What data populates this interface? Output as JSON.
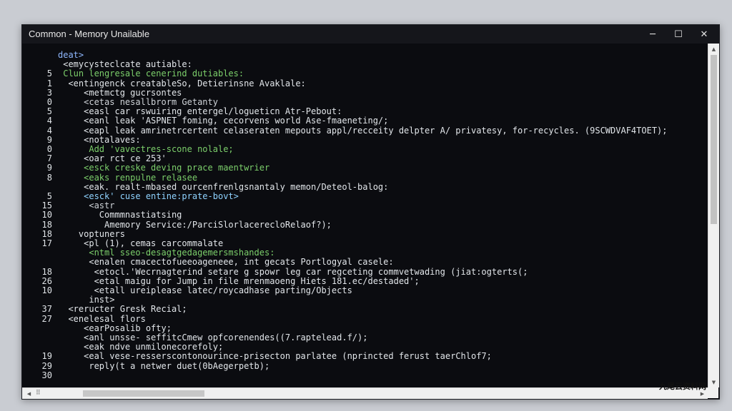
{
  "window": {
    "title": "Common - Memory Unailable",
    "controls": {
      "minimize": "─",
      "maximize": "☐",
      "close": "✕"
    }
  },
  "code_lines": [
    {
      "num": "",
      "text": "deat>",
      "color": "c-blue"
    },
    {
      "num": "",
      "text": " <emycysteclcate autiable:",
      "color": "c-white"
    },
    {
      "num": "5",
      "text": " Clun lengresale cenerind dutiables:",
      "color": "c-green"
    },
    {
      "num": "1",
      "text": "  <entingenck creatableSo, Detierinsne Avaklale:",
      "color": "c-white"
    },
    {
      "num": "3",
      "text": "     <metmctg gucrsontes",
      "color": "c-white"
    },
    {
      "num": "0",
      "text": "     <cetas nesallbrorm Getanty",
      "color": "c-gray"
    },
    {
      "num": "5",
      "text": "     <easl car rswuiring entergel/logueticn Atr-Pebout:",
      "color": "c-white"
    },
    {
      "num": "4",
      "text": "     <eanl leak 'ASPNET foming, cecorvens world Ase-fmaeneting/;",
      "color": "c-white"
    },
    {
      "num": "4",
      "text": "     <eapl leak amrinetrcertent celaseraten mepouts appl/recceity delpter A/ privatesy, for-recycles. (9SCWDVAF4TOET);",
      "color": "c-white"
    },
    {
      "num": "9",
      "text": "     <notalaves:",
      "color": "c-white"
    },
    {
      "num": "0",
      "text": "      Add 'vavectres-scone nolale;",
      "color": "c-green"
    },
    {
      "num": "7",
      "text": "     <oar rct ce 253'",
      "color": "c-white"
    },
    {
      "num": "9",
      "text": "     <esck creske deving prace maentwrier",
      "color": "c-green"
    },
    {
      "num": "8",
      "text": "     <eaks renpulne relasee",
      "color": "c-green"
    },
    {
      "num": "",
      "text": "     <eak. realt-mbased ourcenfrenlgsnantaly memon/Deteol-balog:",
      "color": "c-white"
    },
    {
      "num": "5",
      "text": "     <esck' cuse entine:prate-bovt>",
      "color": "c-cyan"
    },
    {
      "num": "15",
      "text": "      <astr",
      "color": "c-gray"
    },
    {
      "num": "10",
      "text": "        Commmnastiatsing",
      "color": "c-white"
    },
    {
      "num": "18",
      "text": "         Amemory Service:/ParciSlorlacerecloRelaof?);",
      "color": "c-white"
    },
    {
      "num": "18",
      "text": "    voptuners",
      "color": "c-white"
    },
    {
      "num": "17",
      "text": "     <pl (1), cemas carcommalate",
      "color": "c-white"
    },
    {
      "num": "",
      "text": "      <ntml sseo-desagtgedagemersmshandes:",
      "color": "c-green"
    },
    {
      "num": "",
      "text": "      <enalen cmacectofueeoageneee, int gecats Portlogyal casele:",
      "color": "c-white"
    },
    {
      "num": "18",
      "text": "       <etocl.'Wecrnagterind setare g spowr leg car regceting commvetwading (jiat:ogterts(;",
      "color": "c-white"
    },
    {
      "num": "26",
      "text": "       <etal maigu for Jump in file mrenmaoeng Hiets 181.ec/destaded';",
      "color": "c-white"
    },
    {
      "num": "10",
      "text": "       <etall ureiplease latec/roycadhase parting/Objects",
      "color": "c-white"
    },
    {
      "num": "",
      "text": "      inst>",
      "color": "c-white"
    },
    {
      "num": "37",
      "text": "  <reructer Gresk Recial;",
      "color": "c-white"
    },
    {
      "num": "27",
      "text": "  <enelesal flors",
      "color": "c-white"
    },
    {
      "num": "",
      "text": "     <earPosalib ofty;",
      "color": "c-white"
    },
    {
      "num": "",
      "text": "     <anl unsse- seffitcCmew opfcorenendes((7.raptelead.f/);",
      "color": "c-white"
    },
    {
      "num": "",
      "text": "     <eak ndve unmilonecorefoly;",
      "color": "c-white"
    },
    {
      "num": "19",
      "text": "     <eal vese-resserscontonourince-prisecton parlatee (nprincted ferust taerChlof7;",
      "color": "c-white"
    },
    {
      "num": "29",
      "text": "      reply(t a netwer duet(0bAegerpetb);",
      "color": "c-white"
    },
    {
      "num": "30",
      "text": "",
      "color": "c-white"
    }
  ],
  "scrollbars": {
    "up_arrow": "▲",
    "down_arrow": "▼",
    "left_arrow": "◀",
    "right_arrow": "▶",
    "grip": "⠿"
  },
  "watermark": "九尾云资料网"
}
